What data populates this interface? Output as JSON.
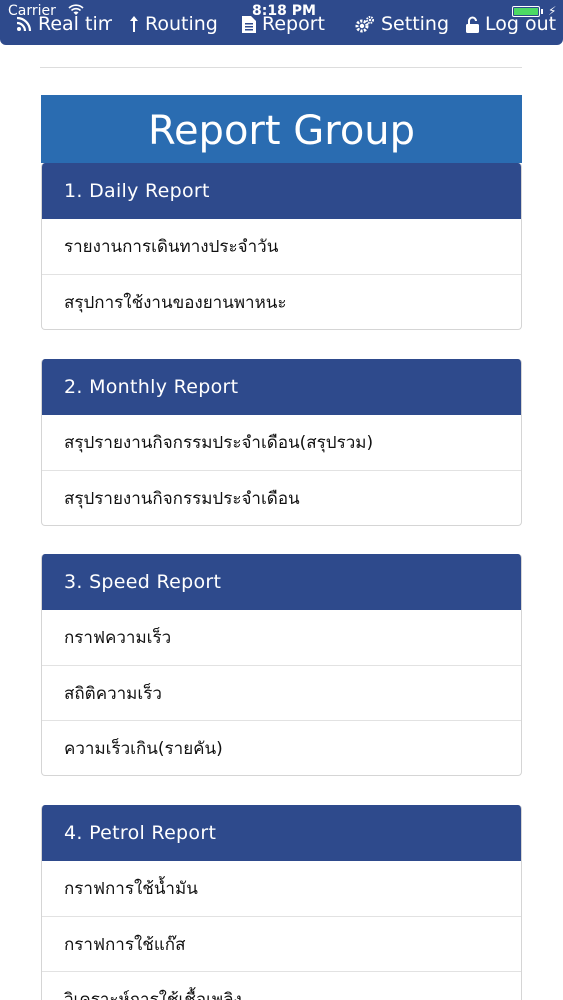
{
  "statusbar": {
    "carrier": "Carrier",
    "time": "8:18 PM"
  },
  "nav": {
    "realtime": "Real tim",
    "routing": "Routing",
    "report": "Report",
    "setting": "Setting",
    "logout": "Log out"
  },
  "colors": {
    "nav_bg": "#2e4a8c",
    "title_bg": "#2a6cb1",
    "header_bg": "#2e4a8c"
  },
  "page_title": "Report Group",
  "groups": [
    {
      "header": "1. Daily Report",
      "items": [
        "รายงานการเดินทางประจำวัน",
        "สรุปการใช้งานของยานพาหนะ"
      ]
    },
    {
      "header": "2. Monthly Report",
      "items": [
        "สรุปรายงานกิจกรรมประจำเดือน(สรุปรวม)",
        "สรุปรายงานกิจกรรมประจำเดือน"
      ]
    },
    {
      "header": "3. Speed Report",
      "items": [
        "กราฟความเร็ว",
        "สถิติความเร็ว",
        "ความเร็วเกิน(รายคัน)"
      ]
    },
    {
      "header": "4. Petrol Report",
      "items": [
        "กราฟการใช้น้ำมัน",
        "กราฟการใช้แก๊ส",
        "วิเคราะห์การใช้เชื้อเพลิง"
      ]
    }
  ]
}
